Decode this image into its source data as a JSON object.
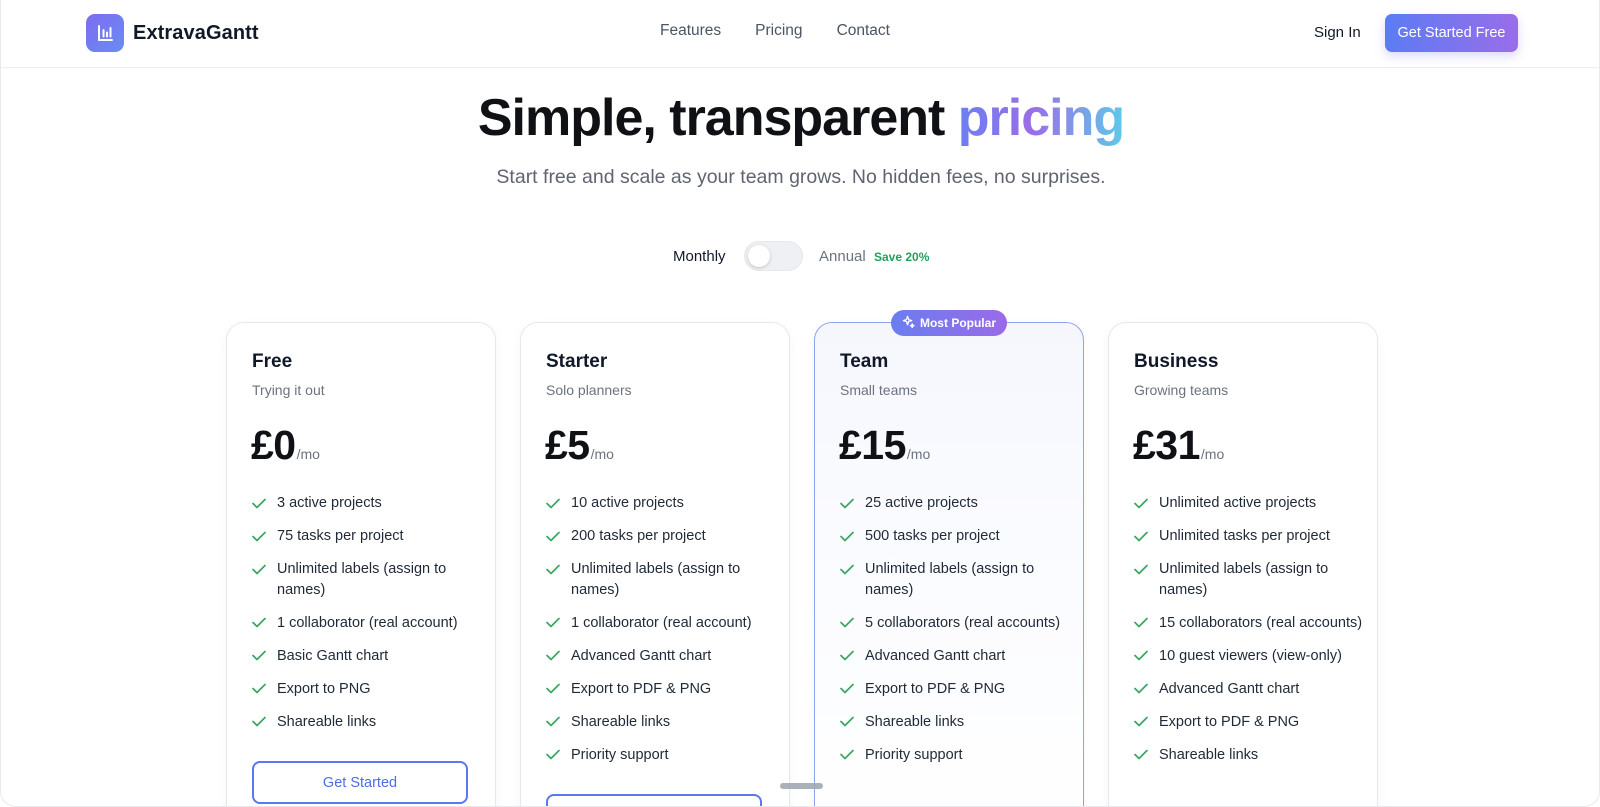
{
  "nav": {
    "brand": "ExtravaGantt",
    "links": [
      "Features",
      "Pricing",
      "Contact"
    ],
    "sign_in": "Sign In",
    "cta": "Get Started Free"
  },
  "hero": {
    "title_main": "Simple, transparent ",
    "title_highlight": "pricing",
    "subtitle": "Start free and scale as your team grows. No hidden fees, no surprises."
  },
  "billing": {
    "monthly_label": "Monthly",
    "annual_label": "Annual",
    "save_label": "Save 20%",
    "annual_selected": false
  },
  "badge": {
    "label": "Most Popular",
    "icon": "sparkle-icon"
  },
  "colors": {
    "accent": "#5b78ec",
    "accent_purple": "#9a6de9",
    "check": "#22a15a"
  },
  "plans": [
    {
      "name": "Free",
      "tagline": "Trying it out",
      "price": "£0",
      "period": "/mo",
      "features": [
        "3 active projects",
        "75 tasks per project",
        "Unlimited labels (assign to names)",
        "1 collaborator (real account)",
        "Basic Gantt chart",
        "Export to PNG",
        "Shareable links"
      ],
      "button": "Get Started"
    },
    {
      "name": "Starter",
      "tagline": "Solo planners",
      "price": "£5",
      "period": "/mo",
      "features": [
        "10 active projects",
        "200 tasks per project",
        "Unlimited labels (assign to names)",
        "1 collaborator (real account)",
        "Advanced Gantt chart",
        "Export to PDF & PNG",
        "Shareable links",
        "Priority support"
      ],
      "button": ""
    },
    {
      "name": "Team",
      "tagline": "Small teams",
      "price": "£15",
      "period": "/mo",
      "features": [
        "25 active projects",
        "500 tasks per project",
        "Unlimited labels (assign to names)",
        "5 collaborators (real accounts)",
        "Advanced Gantt chart",
        "Export to PDF & PNG",
        "Shareable links",
        "Priority support"
      ],
      "button": ""
    },
    {
      "name": "Business",
      "tagline": "Growing teams",
      "price": "£31",
      "period": "/mo",
      "features": [
        "Unlimited active projects",
        "Unlimited tasks per project",
        "Unlimited labels (assign to names)",
        "15 collaborators (real accounts)",
        "10 guest viewers (view-only)",
        "Advanced Gantt chart",
        "Export to PDF & PNG",
        "Shareable links"
      ],
      "button": ""
    }
  ]
}
